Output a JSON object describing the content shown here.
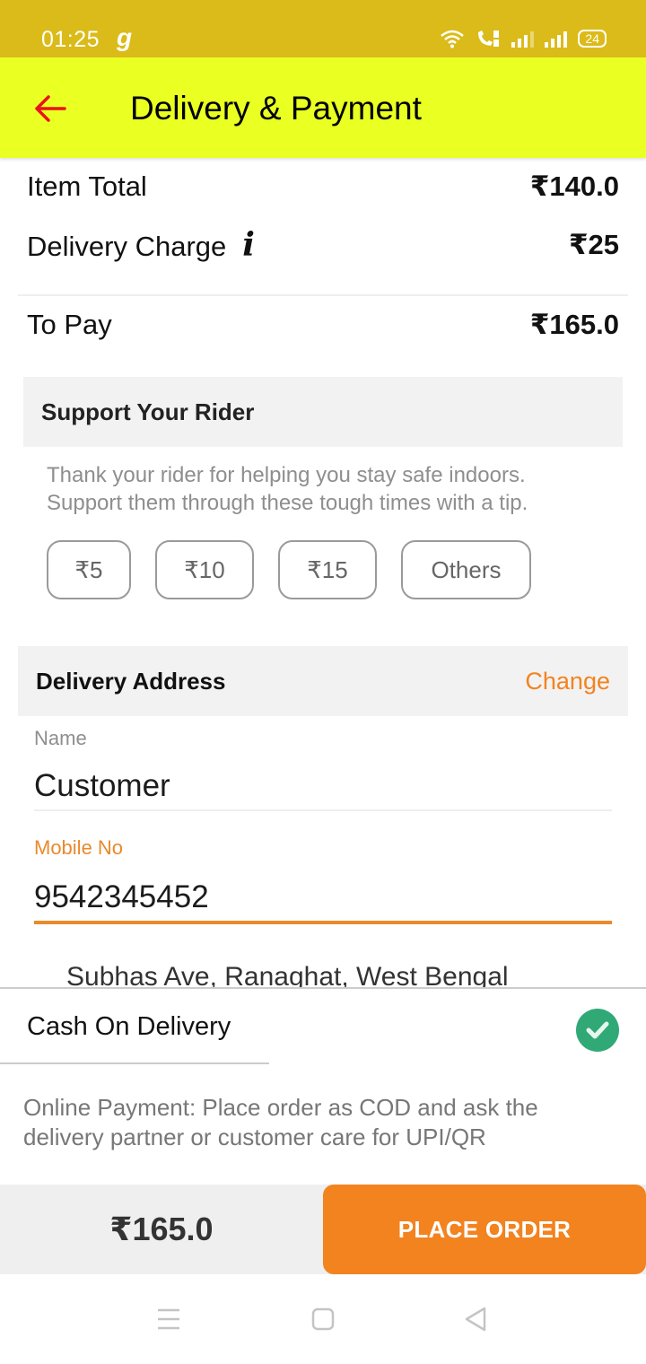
{
  "status_bar": {
    "time": "01:25",
    "app_icon": "g",
    "battery": "24",
    "icons": [
      "wifi-icon",
      "volte-call-icon",
      "signal-sim1-icon",
      "signal-sim2-icon",
      "battery-icon"
    ]
  },
  "app_bar": {
    "title": "Delivery & Payment",
    "back_icon": "arrow-left-icon",
    "back_color": "#e8141a"
  },
  "bill": {
    "item_total_label": "Item Total",
    "item_total_value": "₹140.0",
    "delivery_charge_label": "Delivery Charge",
    "delivery_charge_info_icon": "i",
    "delivery_charge_value": "₹25",
    "to_pay_label": "To Pay",
    "to_pay_value": "₹165.0"
  },
  "rider_support": {
    "heading": "Support Your Rider",
    "description_line1": "Thank your rider for helping you stay safe indoors.",
    "description_line2": "Support them through these tough times with a tip.",
    "tip_options": [
      "₹5",
      "₹10",
      "₹15",
      "Others"
    ]
  },
  "delivery_address": {
    "heading": "Delivery Address",
    "change_label": "Change",
    "name_label": "Name",
    "name_value": "Customer",
    "mobile_label": "Mobile No",
    "mobile_value": "9542345452",
    "address_peek": "Subhas Ave, Ranaghat, West Bengal"
  },
  "payment": {
    "method": "Cash On Delivery",
    "selected": true,
    "online_note": "Online Payment: Place order as COD and ask the delivery partner or customer care for UPI/QR"
  },
  "footer": {
    "total": "₹165.0",
    "place_order_label": "PLACE ORDER"
  },
  "nav_bar": {
    "buttons": [
      "menu-icon",
      "home-icon",
      "back-icon"
    ]
  },
  "colors": {
    "status_bar": "#dbbb19",
    "app_bar": "#eaff22",
    "accent_orange": "#f2831f",
    "check_green": "#30a977",
    "section_bg": "#f2f2f2"
  }
}
